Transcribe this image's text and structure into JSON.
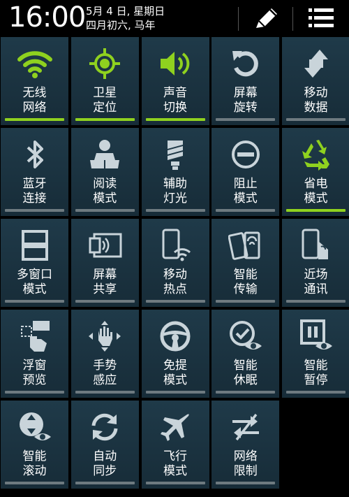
{
  "status": {
    "time": "16:00",
    "date_line1": "5月 4 日, 星期日",
    "date_line2": "四月初六, 马年",
    "edit_icon": "pencil-icon",
    "menu_icon": "list-icon"
  },
  "colors": {
    "active": "#8fd11f",
    "inactive_icon": "#c9d4da",
    "tile_bg": "#1f3a49",
    "bar_off": "#6e7a80"
  },
  "tiles": [
    {
      "label": "无线\n网络",
      "icon": "wifi-icon",
      "active": true
    },
    {
      "label": "卫星\n定位",
      "icon": "gps-icon",
      "active": true
    },
    {
      "label": "声音\n切换",
      "icon": "volume-icon",
      "active": true
    },
    {
      "label": "屏幕\n旋转",
      "icon": "rotate-icon",
      "active": false
    },
    {
      "label": "移动\n数据",
      "icon": "mobile-data-icon",
      "active": false
    },
    {
      "label": "蓝牙\n连接",
      "icon": "bluetooth-icon",
      "active": false
    },
    {
      "label": "阅读\n模式",
      "icon": "reading-icon",
      "active": false
    },
    {
      "label": "辅助\n灯光",
      "icon": "flashlight-icon",
      "active": false
    },
    {
      "label": "阻止\n模式",
      "icon": "block-icon",
      "active": false
    },
    {
      "label": "省电\n模式",
      "icon": "recycle-icon",
      "active": true
    },
    {
      "label": "多窗口\n模式",
      "icon": "multi-window-icon",
      "active": false
    },
    {
      "label": "屏幕\n共享",
      "icon": "screen-share-icon",
      "active": false
    },
    {
      "label": "移动\n热点",
      "icon": "hotspot-icon",
      "active": false
    },
    {
      "label": "智能\n传输",
      "icon": "smart-transfer-icon",
      "active": false
    },
    {
      "label": "近场\n通讯",
      "icon": "nfc-icon",
      "active": false
    },
    {
      "label": "浮窗\n预览",
      "icon": "air-view-icon",
      "active": false
    },
    {
      "label": "手势\n感应",
      "icon": "gesture-icon",
      "active": false
    },
    {
      "label": "免提\n模式",
      "icon": "steering-wheel-icon",
      "active": false
    },
    {
      "label": "智能\n休眠",
      "icon": "smart-stay-icon",
      "active": false
    },
    {
      "label": "智能\n暂停",
      "icon": "smart-pause-icon",
      "active": false
    },
    {
      "label": "智能\n滚动",
      "icon": "smart-scroll-icon",
      "active": false
    },
    {
      "label": "自动\n同步",
      "icon": "sync-icon",
      "active": false
    },
    {
      "label": "飞行\n模式",
      "icon": "airplane-icon",
      "active": false
    },
    {
      "label": "网络\n限制",
      "icon": "network-limit-icon",
      "active": false
    }
  ]
}
